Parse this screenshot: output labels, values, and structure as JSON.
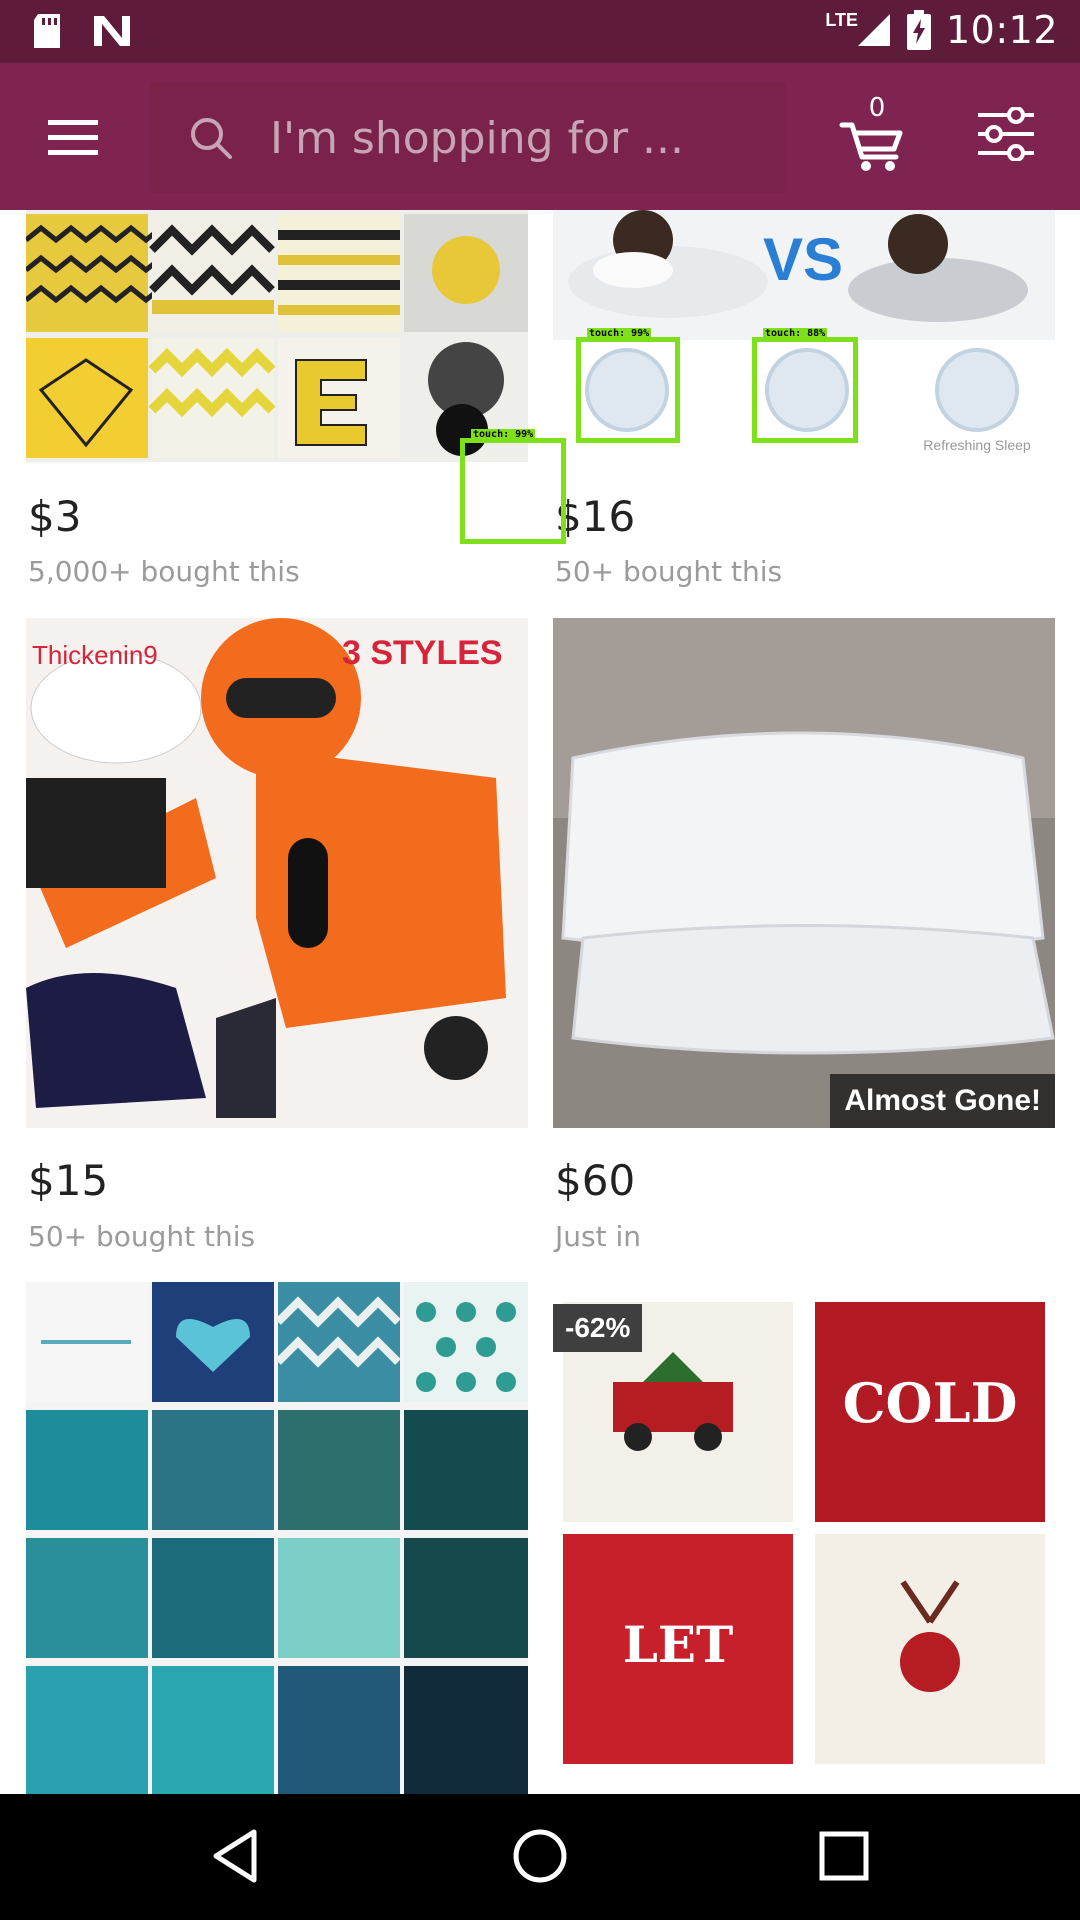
{
  "status_bar": {
    "time": "10:12",
    "network": "LTE",
    "icons": [
      "sd-card-icon",
      "n-notification-icon",
      "signal-icon",
      "battery-charging-icon"
    ]
  },
  "app_bar": {
    "search_placeholder": "I'm shopping for ...",
    "cart_count": "0",
    "colors": {
      "status_bar": "#5e1b3a",
      "app_bar": "#7f2450"
    }
  },
  "products": [
    {
      "price": "$3",
      "subtitle": "5,000+ bought this"
    },
    {
      "price": "$16",
      "subtitle": "50+ bought this"
    },
    {
      "price": "$15",
      "subtitle": "50+ bought this",
      "image_text": [
        "Thickenin9",
        "3 STYLES"
      ]
    },
    {
      "price": "$60",
      "subtitle": "Just in",
      "badge": "Almost Gone!"
    },
    {
      "price": "",
      "subtitle": ""
    },
    {
      "price": "",
      "subtitle": "",
      "badge": "-62%"
    }
  ],
  "touch_overlays": [
    {
      "label": "touch: 99%"
    },
    {
      "label": "touch: 88%"
    },
    {
      "label": "touch: 99%"
    }
  ]
}
